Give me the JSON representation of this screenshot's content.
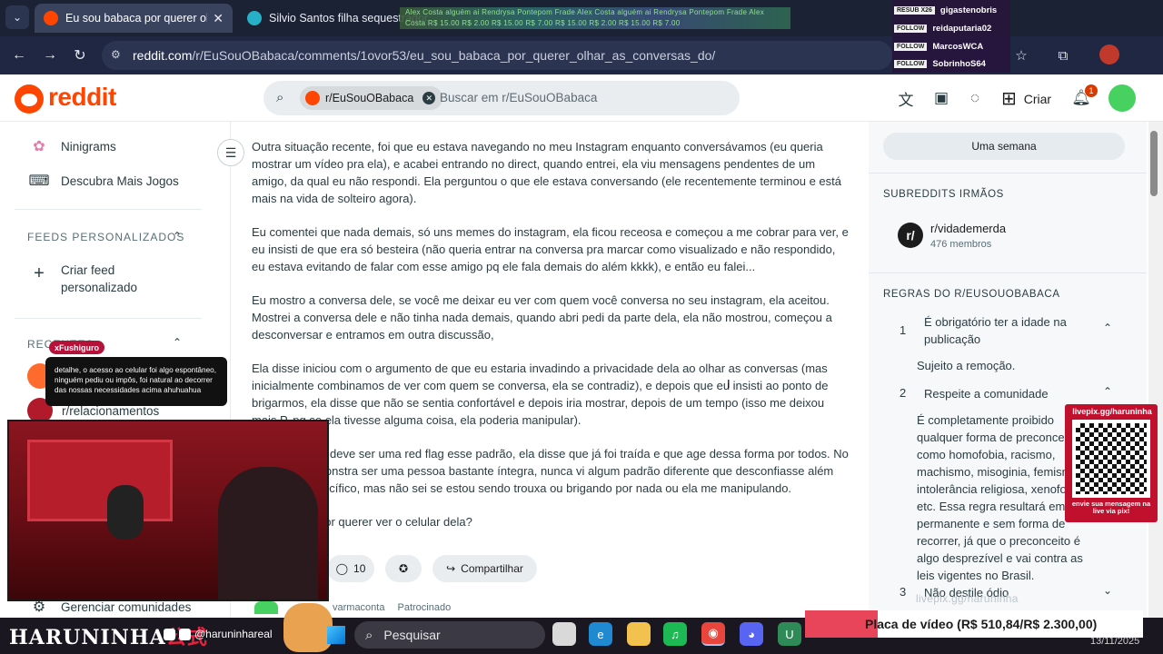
{
  "browser": {
    "active_tab": "Eu sou babaca por querer olhar",
    "inactive_tab": "Silvio Santos filha sequestrador",
    "url_host": "reddit.com",
    "url_path": "/r/EuSouOBabaca/comments/1ovor53/eu_sou_babaca_por_querer_olhar_as_conversas_do/",
    "overlay_ticker": "Alex Costa  alguém ai  Rendrysa  Pontepom  Frade  Alex Costa  alguém ai  Rendrysa  Pontepom  Frade  Alex Costa  R$ 15.00  R$ 2.00  R$ 15.00  R$ 7.00  R$ 15.00  R$ 2.00  R$ 15.00  R$ 7.00",
    "followers": {
      "sub_tag": "RESUB X26",
      "sub_name": "gigastenobris",
      "follow_label": "FOLLOW",
      "f1": "reidaputaria02",
      "f2": "MarcosWCA",
      "f3": "SobrinhoS64"
    }
  },
  "reddit": {
    "logo": "reddit",
    "search_chip": "r/EuSouOBabaca",
    "search_placeholder": "Buscar em r/EuSouOBabaca",
    "create_label": "Criar",
    "notif_count": "1"
  },
  "left_sidebar": {
    "item_ninigrams": "Ninigrams",
    "item_games": "Descubra Mais Jogos",
    "section_feeds": "FEEDS PERSONALIZADOS",
    "create_feed": "Criar feed personalizado",
    "section_recent": "RECENTES",
    "recent_item": "r/relacionamentos",
    "manage_communities": "Gerenciar comunidades"
  },
  "post": {
    "p1": "Outra situação recente, foi que eu estava navegando no meu Instagram enquanto conversávamos (eu queria mostrar um vídeo pra ela), e acabei entrando no direct, quando entrei, ela viu mensagens pendentes de um amigo, da qual eu não respondi. Ela perguntou o que ele estava conversando (ele recentemente terminou e está mais na vida de solteiro agora).",
    "p2": "Eu comentei que nada demais, só uns memes do instagram, ela ficou receosa e começou a me cobrar para ver, e eu insisti de que era só besteira (não queria entrar na conversa pra marcar como visualizado e não respondido, eu estava evitando de falar com esse amigo pq ele fala demais do além kkkk), e então eu falei...",
    "p3": "Eu mostro a conversa dele, se você me deixar eu ver com quem você conversa no seu instagram, ela aceitou. Mostrei a conversa dele e não tinha nada demais, quando abri pedi da parte dela, ela não mostrou, começou a desconversar e entramos em outra discussão,",
    "p4": "Ela disse iniciou com o argumento de que eu estaria invadindo a privacidade dela ao olhar as conversas (mas inicialmente combinamos de ver com quem se conversa, ela se contradiz), e depois que eu insisti ao ponto de brigarmos, ela disse que não se sentia confortável e depois iria mostrar, depois de um tempo (isso me deixou mais P. pq se ela tivesse alguma coisa, ela poderia manipular).",
    "p5": "Acho que sim, deve ser uma red flag esse padrão, ela disse que já foi traída e que age dessa forma por todos. No mais, ela demonstra ser uma pessoa bastante íntegra, nunca vi algum padrão diferente que desconfiasse além deste em específico, mas não sei se estou sendo trouxa ou brigando por nada ou ela me manipulando.",
    "p6": "Sou babaca por querer ver o celular dela?",
    "comments_count": "10",
    "share_label": "Compartilhar",
    "sponsored_name": "varmaconta",
    "sponsored_label": "Patrocinado"
  },
  "right_sidebar": {
    "week_button": "Uma semana",
    "sisters_title": "SUBREDDITS IRMÃOS",
    "sister_name": "r/vidademerda",
    "sister_members": "476 membros",
    "rules_title": "REGRAS DO R/EUSOUOBABACA",
    "rule1_n": "1",
    "rule1_t": "É obrigatório ter a idade na publicação",
    "rule1_body": "Sujeito a remoção.",
    "rule2_n": "2",
    "rule2_t": "Respeite a comunidade",
    "rule2_body": "É completamente proibido qualquer forma de preconceito, como homofobia, racismo, machismo, misoginia, femismo, intolerância religiosa, xenofobia, etc. Essa regra resultará em ban permanente e sem forma de recorrer, já que o preconceito é algo desprezível e vai contra as leis vigentes no Brasil.",
    "rule3_n": "3",
    "rule3_t": "Não destile ódio"
  },
  "stream": {
    "chat_user": "xFushiguro",
    "chat_msg": "detalhe, o acesso ao celular foi algo espontâneo, ninguém pediu ou impôs, foi natural ao decorrer das nossas necessidades acima ahuhuahua",
    "qr_url": "livepix.gg/haruninha",
    "qr_caption": "envie sua mensagem na live via pix!",
    "watermark": "livepix.gg/haruninha",
    "goal": "Placa de vídeo (R$ 510,84/R$ 2.300,00)"
  },
  "taskbar": {
    "brand": "HARUNINHA",
    "brand_jp": "公式",
    "social": "@haruninhareal",
    "search": "Pesquisar",
    "date": "13/11/2025"
  }
}
